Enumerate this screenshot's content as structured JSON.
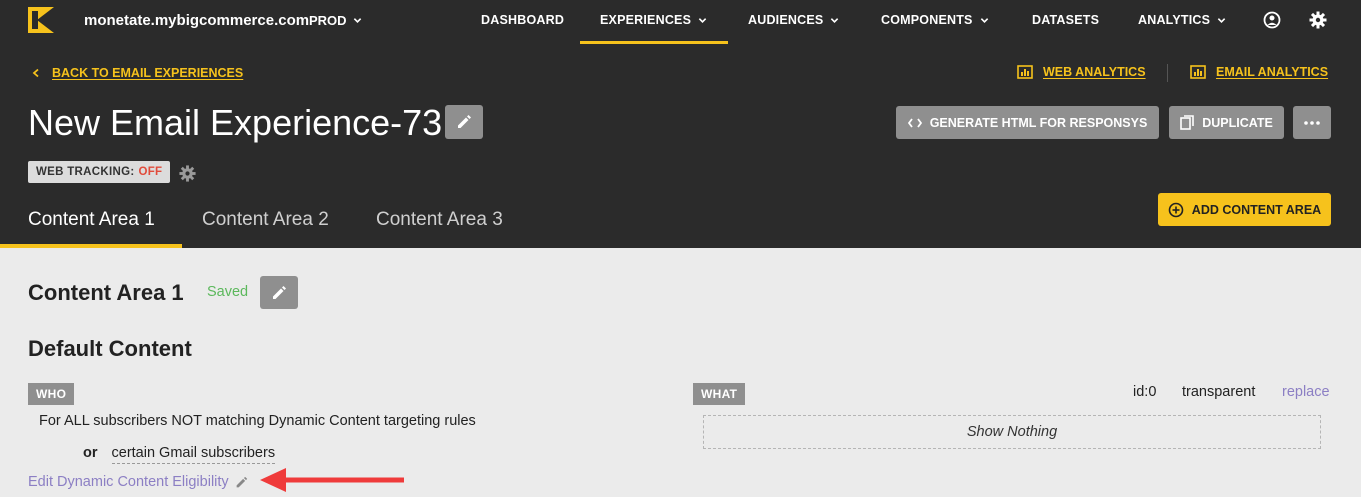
{
  "nav": {
    "site": "monetate.mybigcommerce.com",
    "env": "PROD",
    "items": [
      {
        "label": "DASHBOARD"
      },
      {
        "label": "EXPERIENCES"
      },
      {
        "label": "AUDIENCES"
      },
      {
        "label": "COMPONENTS"
      },
      {
        "label": "DATASETS"
      },
      {
        "label": "ANALYTICS"
      }
    ],
    "active_item": "EXPERIENCES"
  },
  "header": {
    "back_label": "BACK TO EMAIL EXPERIENCES",
    "web_analytics_label": "WEB ANALYTICS",
    "email_analytics_label": "EMAIL ANALYTICS",
    "title": "New Email Experience-73",
    "generate_label": "GENERATE HTML FOR RESPONSYS",
    "duplicate_label": "DUPLICATE",
    "tracking_label": "WEB TRACKING:",
    "tracking_value": "OFF",
    "tabs": [
      {
        "label": "Content Area 1"
      },
      {
        "label": "Content Area 2"
      },
      {
        "label": "Content Area 3"
      }
    ],
    "active_tab": "Content Area 1",
    "add_area_label": "ADD CONTENT AREA"
  },
  "content": {
    "area_title": "Content Area 1",
    "saved_label": "Saved",
    "default_title": "Default Content",
    "who_badge": "WHO",
    "who_text": "For ALL subscribers NOT matching Dynamic Content targeting rules",
    "or_label": "or",
    "condition": "certain Gmail subscribers",
    "edit_eligibility": "Edit Dynamic Content Eligibility",
    "what_badge": "WHAT",
    "what_id": "id:0",
    "what_type": "transparent",
    "replace_label": "replace",
    "show_nothing": "Show Nothing"
  },
  "colors": {
    "accent": "#f6c21c",
    "header_bg": "#2b2b2b",
    "content_bg": "#ebebeb",
    "saved": "#5cb85c",
    "link_purple": "#8c7fc4",
    "tracking_off": "#e14b3b",
    "annotation_arrow": "#ef3b3b"
  }
}
